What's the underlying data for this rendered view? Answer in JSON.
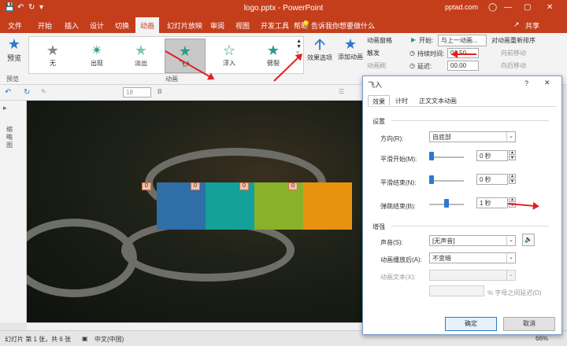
{
  "window": {
    "title": "logo.pptx - PowerPoint",
    "site": "pptad.com",
    "user_icon": "user-icon",
    "colors": {
      "titlebar": "#c43e1c",
      "accent": "#2b79d0"
    }
  },
  "tabs": [
    "文件",
    "开始",
    "插入",
    "设计",
    "切换",
    "动画",
    "幻灯片放映",
    "审阅",
    "视图",
    "开发工具",
    "帮助"
  ],
  "active_tab": "动画",
  "tell_me": "告诉我你想要做什么",
  "share": "共享",
  "ribbon": {
    "preview": {
      "label": "预览",
      "group": "预览"
    },
    "animations": [
      {
        "label": "无",
        "color": "#888888"
      },
      {
        "label": "出现",
        "color": "#2e9a8a"
      },
      {
        "label": "淡出",
        "color": "#2e9a8a"
      },
      {
        "label": "飞入",
        "color": "#2e9a8a"
      },
      {
        "label": "浮入",
        "color": "#2e9a8a"
      },
      {
        "label": "劈裂",
        "color": "#2e9a8a"
      }
    ],
    "animation_group": "动画",
    "effect_options": "效果选项",
    "add_animation": "添加动画",
    "animation_pane": "动画窗格",
    "trigger": "触发",
    "animation_painter": "动画刷",
    "start_label": "开始:",
    "start_value": "与上一动画...",
    "duration_label": "持续时间:",
    "duration_value": "01.50",
    "delay_label": "延迟:",
    "delay_value": "00.00",
    "reorder": "对动画重新排序",
    "move_earlier": "向前移动",
    "move_later": "向后移动"
  },
  "strip": {
    "font_size": "18"
  },
  "left_pane_label": "缩略图",
  "slide": {
    "boxes": [
      {
        "color": "#2f6ea6"
      },
      {
        "color": "#13a19a"
      },
      {
        "color": "#8ab12a"
      },
      {
        "color": "#e8930e"
      }
    ],
    "tags": [
      "0",
      "0",
      "0",
      "0"
    ]
  },
  "status": {
    "slide_info": "幻灯片 第 1 张，共 6 张",
    "language": "中文(中国)",
    "zoom": "66%"
  },
  "dialog": {
    "title": "飞入",
    "help": "?",
    "tabs": [
      "效果",
      "计时",
      "正文文本动画"
    ],
    "settings_group": "设置",
    "direction_label": "方向(R):",
    "direction_value": "自底部",
    "smooth_start_label": "平滑开始(M):",
    "smooth_start_value": "0 秒",
    "smooth_start_level": 0,
    "smooth_end_label": "平滑结束(N):",
    "smooth_end_value": "0 秒",
    "smooth_end_level": 0,
    "bounce_end_label": "弹跳结束(B):",
    "bounce_end_value": "1 秒",
    "bounce_end_level": 0.5,
    "enhance_group": "增强",
    "sound_label": "声音(S):",
    "sound_value": "[无声音]",
    "after_anim_label": "动画播放后(A):",
    "after_anim_value": "不变暗",
    "anim_text_label": "动画文本(X):",
    "anim_text_value": "",
    "percent_label": "% 字母之间延迟(D)",
    "ok": "确定",
    "cancel": "取消"
  }
}
